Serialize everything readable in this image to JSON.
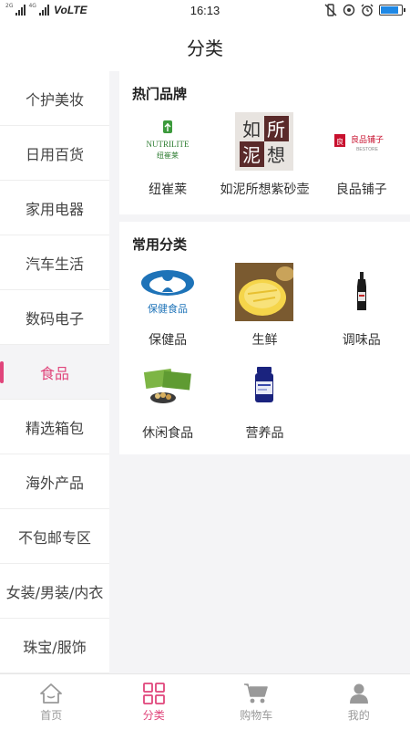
{
  "status_bar": {
    "sim1": "2G",
    "sim2": "4G",
    "network": "VoLTE",
    "time": "16:13"
  },
  "header": {
    "title": "分类"
  },
  "sidebar": {
    "items": [
      {
        "label": "个护美妆"
      },
      {
        "label": "日用百货"
      },
      {
        "label": "家用电器"
      },
      {
        "label": "汽车生活"
      },
      {
        "label": "数码电子"
      },
      {
        "label": "食品",
        "active": true
      },
      {
        "label": "精选箱包"
      },
      {
        "label": "海外产品"
      },
      {
        "label": "不包邮专区"
      },
      {
        "label": "女装/男装/内衣"
      },
      {
        "label": "珠宝/服饰"
      }
    ]
  },
  "hot_brands": {
    "title": "热门品牌",
    "items": [
      {
        "label": "纽崔莱",
        "logo_text": "NUTRILITE",
        "logo_subtext": "纽崔莱"
      },
      {
        "label": "如泥所想紫砂壶",
        "logo_chars": [
          "如",
          "所",
          "泥",
          "想"
        ]
      },
      {
        "label": "良品铺子",
        "logo_text": "良品铺子",
        "logo_subtext": "BESTORE"
      }
    ]
  },
  "common_categories": {
    "title": "常用分类",
    "items": [
      {
        "label": "保健品",
        "logo_text": "保健食品"
      },
      {
        "label": "生鲜"
      },
      {
        "label": "调味品"
      },
      {
        "label": "休闲食品"
      },
      {
        "label": "营养品"
      }
    ]
  },
  "tabbar": {
    "items": [
      {
        "label": "首页",
        "icon": "home-icon"
      },
      {
        "label": "分类",
        "icon": "category-icon",
        "active": true
      },
      {
        "label": "购物车",
        "icon": "cart-icon"
      },
      {
        "label": "我的",
        "icon": "user-icon"
      }
    ]
  },
  "colors": {
    "accent": "#e0457b",
    "background": "#f4f4f6",
    "inactive": "#999999"
  }
}
